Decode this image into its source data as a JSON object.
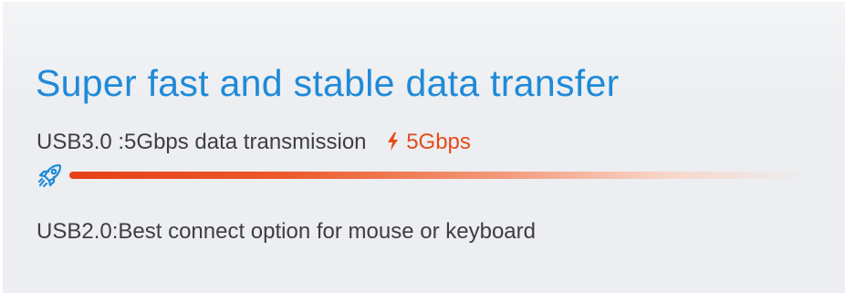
{
  "headline": "Super fast and stable data transfer",
  "usb3": {
    "label": "USB3.0 :5Gbps data transmission",
    "speed_label": "5Gbps",
    "accent_color": "#e64a1a",
    "icons": [
      "lightning-bolt-icon",
      "rocket-icon"
    ]
  },
  "usb2": {
    "label": "USB2.0:Best connect option for mouse or keyboard"
  },
  "colors": {
    "headline": "#1f8ad8",
    "body_text": "#3e3e40",
    "background": "#eceef1"
  }
}
